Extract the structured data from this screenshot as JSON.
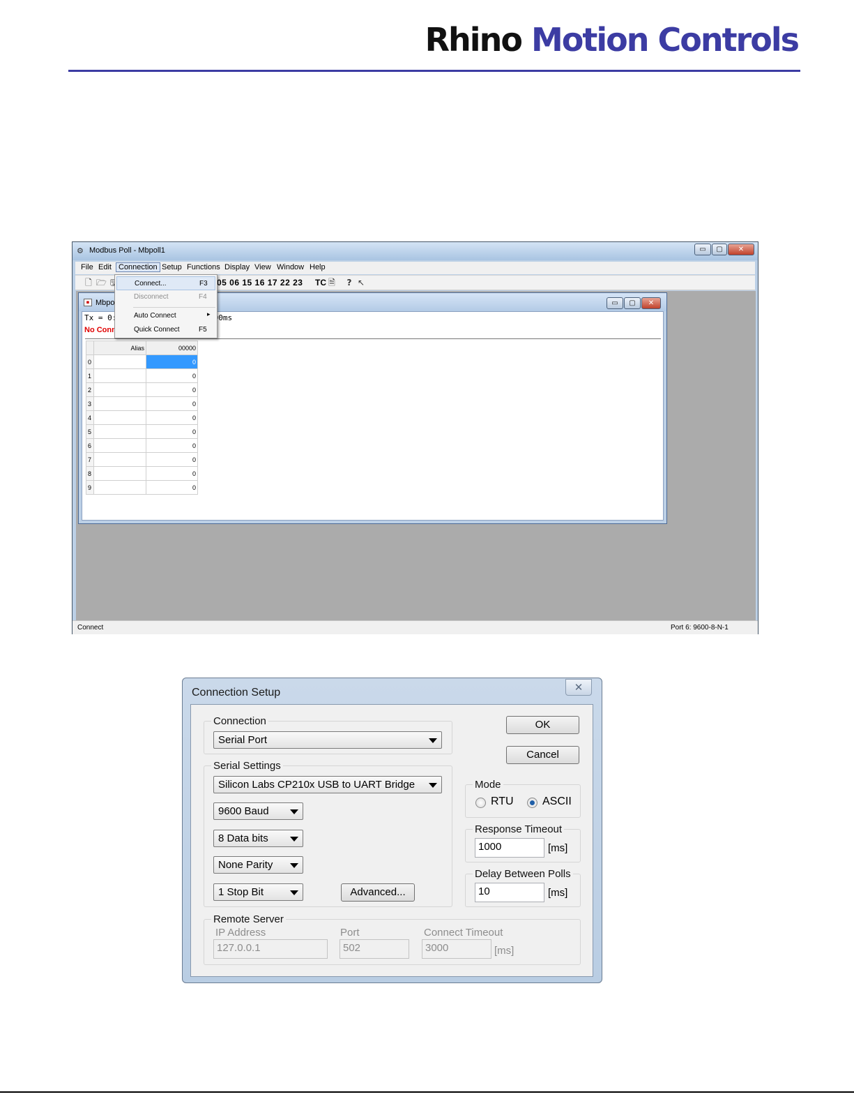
{
  "logo": {
    "part1": "Rhino",
    "part2": "Motion Controls",
    "brand_color": "#3c3ca3"
  },
  "main_window": {
    "title": "Modbus Poll - Mbpoll1",
    "controls": {
      "minimize": "▭",
      "maximize": "▢",
      "close": "✕"
    },
    "menu": [
      "File",
      "Edit",
      "Connection",
      "Setup",
      "Functions",
      "Display",
      "View",
      "Window",
      "Help"
    ],
    "toolbar": {
      "function_codes": "05 06 15 16 17 22 23",
      "tc": "TC"
    },
    "connection_menu": [
      {
        "label": "Connect...",
        "key": "F3",
        "state": "highlighted"
      },
      {
        "label": "Disconnect",
        "key": "F4",
        "state": "disabled"
      },
      {
        "label": "Auto Connect",
        "key": "",
        "state": "submenu"
      },
      {
        "label": "Quick Connect",
        "key": "F5",
        "state": "normal"
      }
    ],
    "child_window": {
      "title": "Mbpol",
      "tx_line_start": "Tx = 0: E",
      "tx_line_end": "000ms",
      "status_text": "No Conn",
      "table": {
        "headers": {
          "alias": "Alias",
          "address": "00000"
        },
        "rows": [
          {
            "index": "0",
            "value": "0"
          },
          {
            "index": "1",
            "value": "0"
          },
          {
            "index": "2",
            "value": "0"
          },
          {
            "index": "3",
            "value": "0"
          },
          {
            "index": "4",
            "value": "0"
          },
          {
            "index": "5",
            "value": "0"
          },
          {
            "index": "6",
            "value": "0"
          },
          {
            "index": "7",
            "value": "0"
          },
          {
            "index": "8",
            "value": "0"
          },
          {
            "index": "9",
            "value": "0"
          }
        ]
      }
    },
    "statusbar": {
      "left": "Connect",
      "right": "Port 6: 9600-8-N-1"
    }
  },
  "connection_setup": {
    "title": "Connection Setup",
    "close_glyph": "✕",
    "connection_group": {
      "label": "Connection",
      "value": "Serial Port"
    },
    "serial_settings": {
      "label": "Serial Settings",
      "port": "Silicon Labs CP210x USB to UART Bridge",
      "baud": "9600 Baud",
      "data_bits": "8 Data bits",
      "parity": "None Parity",
      "stop_bits": "1 Stop Bit",
      "advanced_button": "Advanced..."
    },
    "ok_button": "OK",
    "cancel_button": "Cancel",
    "mode": {
      "label": "Mode",
      "rtu": "RTU",
      "ascii": "ASCII",
      "selected": "ASCII"
    },
    "response_timeout": {
      "label": "Response Timeout",
      "value": "1000",
      "unit": "[ms]"
    },
    "delay_between_polls": {
      "label": "Delay Between Polls",
      "value": "10",
      "unit": "[ms]"
    },
    "remote_server": {
      "label": "Remote Server",
      "ip_label": "IP Address",
      "ip_value": "127.0.0.1",
      "port_label": "Port",
      "port_value": "502",
      "timeout_label": "Connect Timeout",
      "timeout_value": "3000",
      "timeout_unit": "[ms]"
    }
  }
}
